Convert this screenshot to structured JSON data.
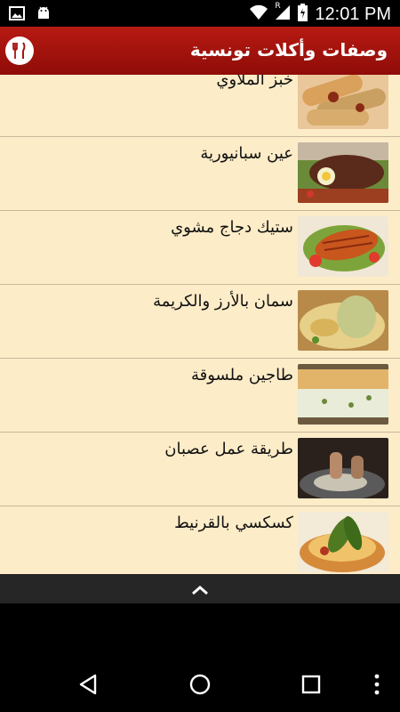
{
  "status": {
    "time": "12:01 PM",
    "carrier_badge": "R"
  },
  "appbar": {
    "title": "وصفات وأكلات تونسية"
  },
  "list": [
    {
      "title": "خبز الملاوي"
    },
    {
      "title": "عين سبانيورية"
    },
    {
      "title": "ستيك دجاج مشوي"
    },
    {
      "title": "سمان بالأرز والكريمة"
    },
    {
      "title": "طاجين ملسوقة"
    },
    {
      "title": "طريقة عمل عصبان"
    },
    {
      "title": "كسكسي بالقرنيط"
    }
  ],
  "colors": {
    "accent": "#a31410",
    "list_bg": "#fdecc8"
  }
}
